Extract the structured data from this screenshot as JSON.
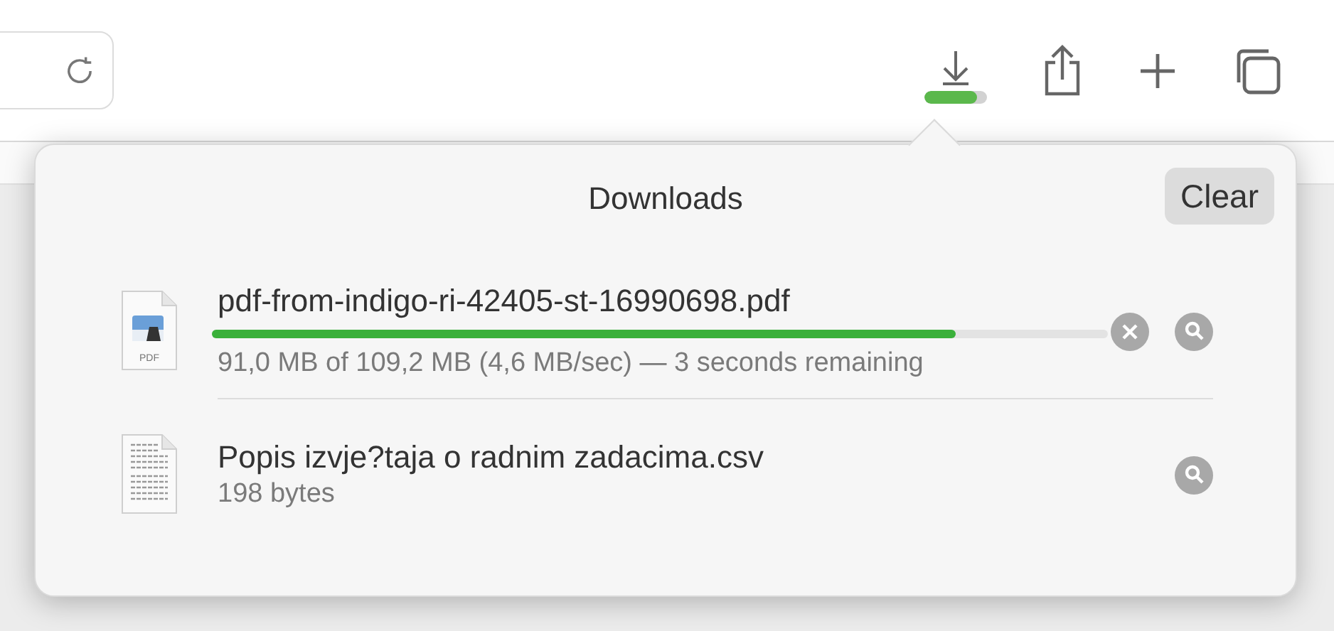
{
  "toolbar": {
    "download_progress": {
      "level": 0.85
    }
  },
  "downloads": {
    "title": "Downloads",
    "clear_button": "Clear",
    "items": [
      {
        "kind": "pdf",
        "name": "pdf-from-indigo-ri-42405-st-16990698.pdf",
        "in_progress": true,
        "level": 0.83,
        "status": "91,0 MB of 109,2 MB (4,6 MB/sec) — 3 seconds remaining",
        "icon_label": "PDF"
      },
      {
        "kind": "text",
        "name": "Popis izvje?taja o radnim zadacima.csv",
        "in_progress": false,
        "status": "198 bytes"
      }
    ]
  }
}
